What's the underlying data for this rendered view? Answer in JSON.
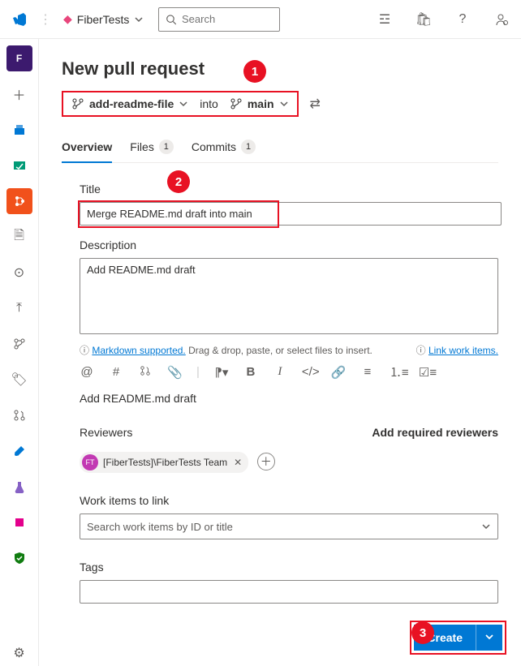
{
  "header": {
    "project_name": "FiberTests",
    "search_placeholder": "Search"
  },
  "page": {
    "title": "New pull request",
    "source_branch": "add-readme-file",
    "into_label": "into",
    "target_branch": "main"
  },
  "tabs": {
    "overview": "Overview",
    "files": "Files",
    "files_count": "1",
    "commits": "Commits",
    "commits_count": "1"
  },
  "form": {
    "title_label": "Title",
    "title_value": "Merge README.md draft into main",
    "description_label": "Description",
    "description_value": "Add README.md draft",
    "markdown_link": "Markdown supported.",
    "markdown_hint": " Drag & drop, paste, or select files to insert.",
    "link_work_items": "Link work items.",
    "preview_text": "Add README.md draft",
    "reviewers_label": "Reviewers",
    "add_required": "Add required reviewers",
    "reviewer_chip": "[FiberTests]\\FiberTests Team",
    "reviewer_initials": "FT",
    "work_items_label": "Work items to link",
    "work_items_placeholder": "Search work items by ID or title",
    "tags_label": "Tags"
  },
  "actions": {
    "create": "Create"
  },
  "callouts": {
    "c1": "1",
    "c2": "2",
    "c3": "3"
  }
}
